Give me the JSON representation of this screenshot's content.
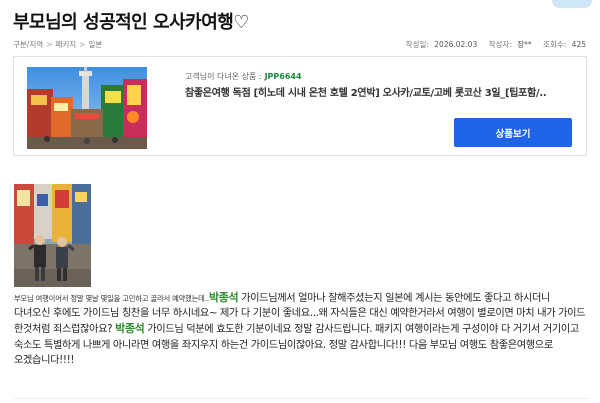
{
  "header": {
    "title": "부모님의 성공적인 오사카여행♡"
  },
  "meta": {
    "breadcrumb": [
      "구분/지역",
      "패키지",
      "일본"
    ],
    "date_label": "작성일",
    "date": "2026.02.03",
    "author_label": "작성자",
    "author": "장**",
    "views_label": "조회수",
    "views": "425"
  },
  "product": {
    "label": "고객님이 다녀온 상품 :",
    "code": "JPP6644",
    "name": "참좋은여행 독점 [히노데 시내 온천 호텔 2연박] 오사카/교토/고베 롯코산 3일_[팁포함/..",
    "button_label": "상품보기"
  },
  "review": {
    "intro": "부모님 여행이어서 정말 몇날 몇일을 고민하고 골라서 예약했는데..",
    "guide_name_1": "박종석",
    "text_1": " 가이드님께서 얼마나 잘해주셨는지 일본에 계시는 동안에도 좋다고 하시더니 다녀오신 후에도 가이드님 칭찬을 너무 하시네요~ 제가 다 기분이 좋네요...왜 자식들은 대신 예약한거라서 여행이 별로이면 마치 내가 가이드 한것처럼 죄스럽잖아요? ",
    "guide_name_2": "박종석",
    "text_2": " 가이드님 덕분에 효도한 기분이네요 정말 감사드립니다. 패키지 여행이라는게 구성이야 다 거기서 거기이고 숙소도 특별하게 나쁘게 아니라면 여행을 좌지우지 하는건 가이드님이잖아요. 정말 감사합니다!!! 다음 부모님 여행도 참좋은여행으로 오겠습니다!!!!"
  },
  "colors": {
    "accent_button": "#1f63e6",
    "product_code": "#1a8a3a",
    "guide_name": "#2e8b2e"
  }
}
